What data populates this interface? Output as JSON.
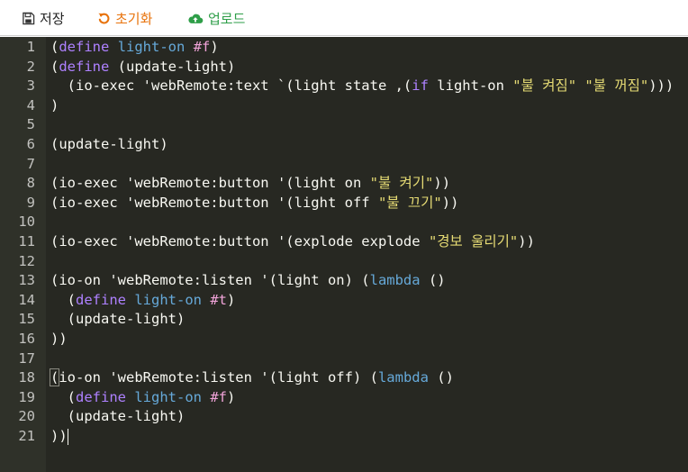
{
  "toolbar": {
    "save_label": "저장",
    "reset_label": "초기화",
    "upload_label": "업로드",
    "colors": {
      "save": "#222222",
      "reset": "#e8730c",
      "upload": "#2e9e48"
    }
  },
  "editor": {
    "theme_colors": {
      "background": "#272822",
      "gutter": "#2f3129",
      "keyword": "#ae81ff",
      "variable": "#66a9d9",
      "string": "#e6db74",
      "boolean": "#f0a3d8",
      "plain": "#f8f8f2"
    },
    "cursor_line": 21,
    "lines": [
      {
        "n": "1",
        "tokens": [
          [
            "p",
            "("
          ],
          [
            "k",
            "define"
          ],
          [
            "t",
            " "
          ],
          [
            "v",
            "light-on"
          ],
          [
            "t",
            " "
          ],
          [
            "b",
            "#f"
          ],
          [
            "p",
            ")"
          ]
        ]
      },
      {
        "n": "2",
        "tokens": [
          [
            "p",
            "("
          ],
          [
            "k",
            "define"
          ],
          [
            "t",
            " (update-light)"
          ]
        ]
      },
      {
        "n": "3",
        "tokens": [
          [
            "t",
            "  (io-exec 'webRemote:text `(light state ,("
          ],
          [
            "k",
            "if"
          ],
          [
            "t",
            " light-on "
          ],
          [
            "s",
            "\"불 켜짐\""
          ],
          [
            "t",
            " "
          ],
          [
            "s",
            "\"불 꺼짐\""
          ],
          [
            "t",
            ")))"
          ]
        ]
      },
      {
        "n": "4",
        "tokens": [
          [
            "p",
            ")"
          ]
        ]
      },
      {
        "n": "5",
        "tokens": []
      },
      {
        "n": "6",
        "tokens": [
          [
            "t",
            "(update-light)"
          ]
        ]
      },
      {
        "n": "7",
        "tokens": []
      },
      {
        "n": "8",
        "tokens": [
          [
            "t",
            "(io-exec 'webRemote:button '(light on "
          ],
          [
            "s",
            "\"불 켜기\""
          ],
          [
            "t",
            "))"
          ]
        ]
      },
      {
        "n": "9",
        "tokens": [
          [
            "t",
            "(io-exec 'webRemote:button '(light off "
          ],
          [
            "s",
            "\"불 끄기\""
          ],
          [
            "t",
            "))"
          ]
        ]
      },
      {
        "n": "10",
        "tokens": []
      },
      {
        "n": "11",
        "tokens": [
          [
            "t",
            "(io-exec 'webRemote:button '(explode explode "
          ],
          [
            "s",
            "\"경보 울리기\""
          ],
          [
            "t",
            "))"
          ]
        ]
      },
      {
        "n": "12",
        "tokens": []
      },
      {
        "n": "13",
        "tokens": [
          [
            "t",
            "(io-on 'webRemote:listen '(light on) ("
          ],
          [
            "v",
            "lambda"
          ],
          [
            "t",
            " ()"
          ]
        ]
      },
      {
        "n": "14",
        "tokens": [
          [
            "t",
            "  ("
          ],
          [
            "k",
            "define"
          ],
          [
            "t",
            " "
          ],
          [
            "v",
            "light-on"
          ],
          [
            "t",
            " "
          ],
          [
            "b",
            "#t"
          ],
          [
            "t",
            ")"
          ]
        ]
      },
      {
        "n": "15",
        "tokens": [
          [
            "t",
            "  (update-light)"
          ]
        ]
      },
      {
        "n": "16",
        "tokens": [
          [
            "t",
            "))"
          ]
        ]
      },
      {
        "n": "17",
        "tokens": []
      },
      {
        "n": "18",
        "tokens": [
          [
            "m",
            "("
          ],
          [
            "t",
            "io-on 'webRemote:listen '(light off) ("
          ],
          [
            "v",
            "lambda"
          ],
          [
            "t",
            " ()"
          ]
        ]
      },
      {
        "n": "19",
        "tokens": [
          [
            "t",
            "  ("
          ],
          [
            "k",
            "define"
          ],
          [
            "t",
            " "
          ],
          [
            "v",
            "light-on"
          ],
          [
            "t",
            " "
          ],
          [
            "b",
            "#f"
          ],
          [
            "t",
            ")"
          ]
        ]
      },
      {
        "n": "20",
        "tokens": [
          [
            "t",
            "  (update-light)"
          ]
        ]
      },
      {
        "n": "21",
        "tokens": [
          [
            "t",
            "))"
          ],
          [
            "c",
            ""
          ]
        ]
      }
    ]
  }
}
